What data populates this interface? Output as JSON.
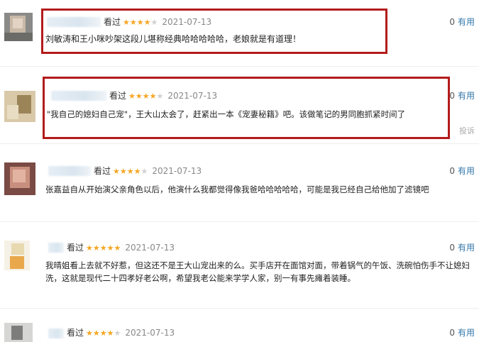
{
  "useful_label": "有用",
  "seen_label": "看过",
  "report_label": "投诉",
  "colors": {
    "star": "#f5a623",
    "link": "#3377aa",
    "highlight": "#b31b1b"
  },
  "comments": [
    {
      "rating": 4,
      "date": "2021-07-13",
      "useful_count": "0",
      "text": "刘敏涛和王小咪吵架这段儿堪称经典哈哈哈哈哈，老娘就是有道理！"
    },
    {
      "rating": 4,
      "date": "2021-07-13",
      "useful_count": "0",
      "text": "\"我自己的媳妇自己宠\"，王大山太会了，赶紧出一本《宠妻秘籍》吧。该做笔记的男同胞抓紧时间了"
    },
    {
      "rating": 4,
      "date": "2021-07-13",
      "useful_count": "0",
      "text": "张嘉益自从开始演父亲角色以后，他演什么我都觉得像我爸哈哈哈哈哈，可能是我已经自己给他加了滤镜吧"
    },
    {
      "rating": 5,
      "date": "2021-07-13",
      "useful_count": "0",
      "text": "我晴姐看上去就不好惹，但这还不是王大山宠出来的么。买手店开在面馆对面，带着锅气的午饭、洗碗怕伤手不让媳妇洗，这就是现代二十四孝好老公啊，希望我老公能来学学人家，别一有事先瘫着装睡。"
    },
    {
      "rating": 4,
      "date": "2021-07-13",
      "useful_count": "0",
      "text": ""
    }
  ]
}
